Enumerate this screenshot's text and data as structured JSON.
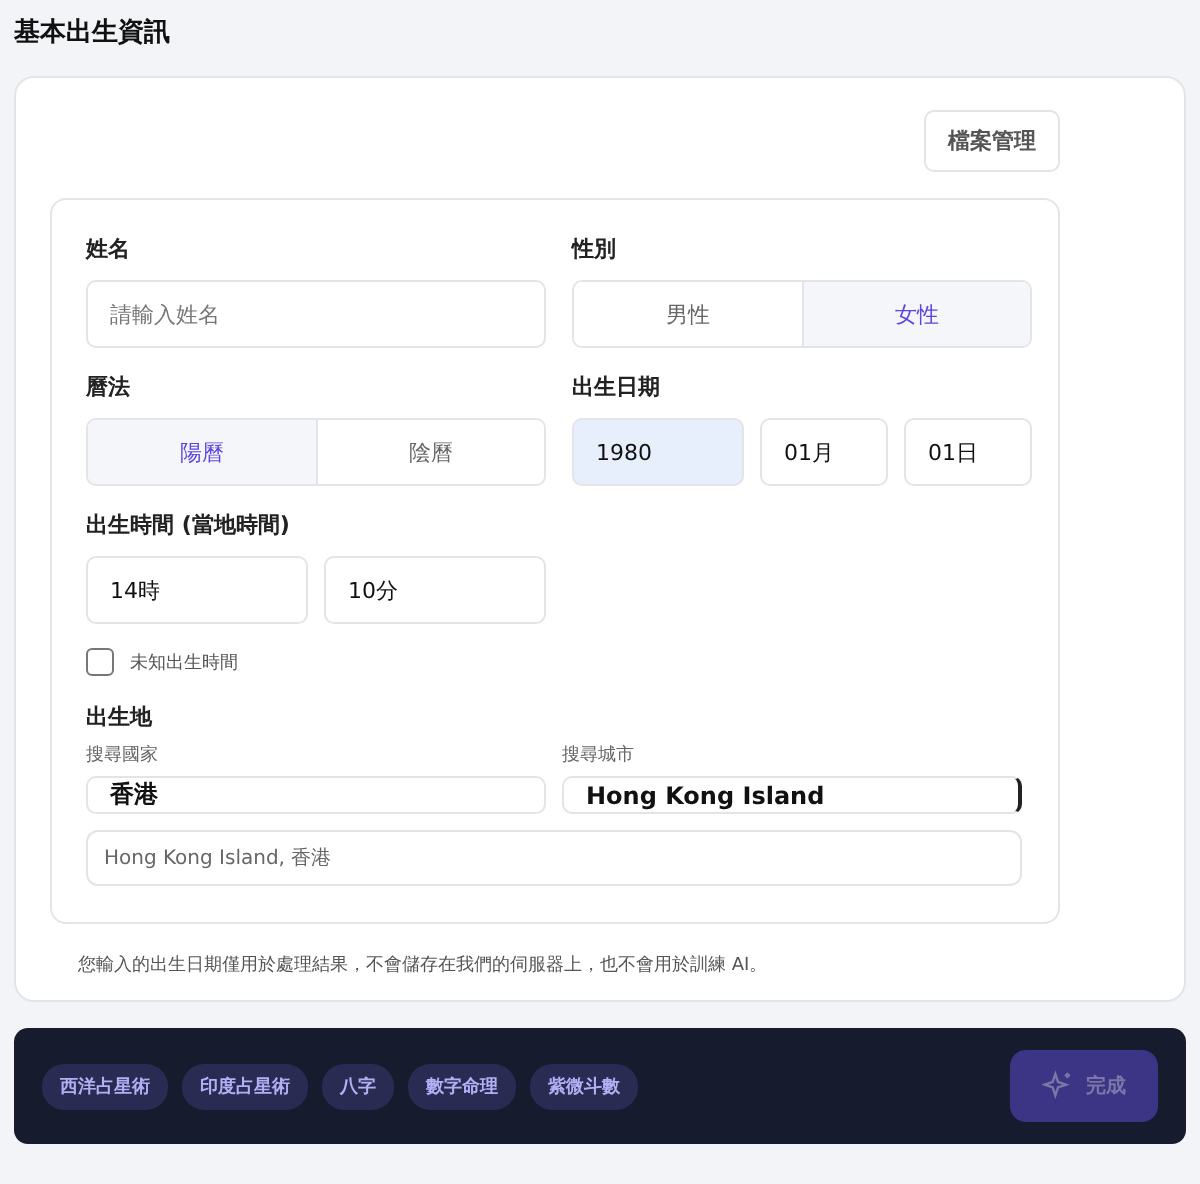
{
  "title": "基本出生資訊",
  "manage_button": "檔案管理",
  "name": {
    "label": "姓名",
    "placeholder": "請輸入姓名"
  },
  "gender": {
    "label": "性別",
    "options": [
      {
        "label": "男性",
        "selected": false
      },
      {
        "label": "女性",
        "selected": true
      }
    ]
  },
  "calendar": {
    "label": "曆法",
    "options": [
      {
        "label": "陽曆",
        "selected": true
      },
      {
        "label": "陰曆",
        "selected": false
      }
    ]
  },
  "birth_date": {
    "label": "出生日期",
    "fields": [
      {
        "value": "1980",
        "selected": true
      },
      {
        "value": "01月",
        "selected": false
      },
      {
        "value": "01日",
        "selected": false
      }
    ]
  },
  "birth_time": {
    "label": "出生時間 (當地時間)",
    "fields": [
      "14時",
      "10分"
    ],
    "unknown": {
      "label": "未知出生時間",
      "checked": false
    }
  },
  "birth_place": {
    "label": "出生地",
    "country": {
      "label": "搜尋國家",
      "value": "香港"
    },
    "city": {
      "label": "搜尋城市",
      "value": "Hong Kong Island"
    },
    "result": "Hong Kong Island, 香港"
  },
  "notice": "您輸入的出生日期僅用於處理結果，不會儲存在我們的伺服器上，也不會用於訓練 AI。",
  "footer": {
    "tags": [
      "西洋占星術",
      "印度占星術",
      "八字",
      "數字命理",
      "紫微斗數"
    ],
    "done_button": {
      "label": "完成",
      "disabled": true
    }
  }
}
